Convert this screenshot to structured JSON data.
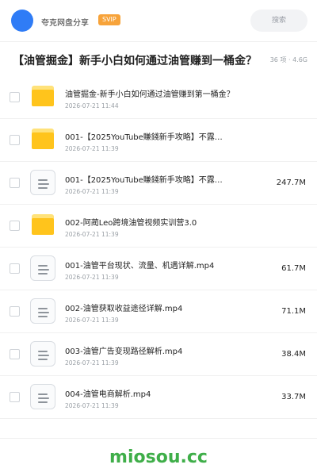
{
  "header": {
    "share_title": "夸克网盘分享",
    "badge": "SVIP",
    "search_placeholder": "搜索",
    "avatar_color": "#2f7cf6"
  },
  "folder": {
    "title": "【油管掘金】新手小白如何通过油管赚到一桶金？",
    "meta": "36 项 · 4.6G"
  },
  "files": [
    {
      "icon": "folder-icon",
      "name": "油管掘金-新手小白如何通过油管赚到第一桶金？",
      "date": "2026-07-21 11:44",
      "size": ""
    },
    {
      "icon": "folder-icon",
      "name": "001-【2025YouTube賺錢新手攻略】不露…",
      "date": "2026-07-21 11:39",
      "size": ""
    },
    {
      "icon": "document-icon",
      "name": "001-【2025YouTube賺錢新手攻略】不露…",
      "date": "2026-07-21 11:39",
      "size": "247.7M"
    },
    {
      "icon": "folder-icon",
      "name": "002-阿蔺Leo跨境油管视频实训营3.0",
      "date": "2026-07-21 11:39",
      "size": ""
    },
    {
      "icon": "document-icon",
      "name": "001-油管平台现状、流量、机遇详解.mp4",
      "date": "2026-07-21 11:39",
      "size": "61.7M"
    },
    {
      "icon": "document-icon",
      "name": "002-油管获取收益途径详解.mp4",
      "date": "2026-07-21 11:39",
      "size": "71.1M"
    },
    {
      "icon": "document-icon",
      "name": "003-油管广告变现路径解析.mp4",
      "date": "2026-07-21 11:39",
      "size": "38.4M"
    },
    {
      "icon": "document-icon",
      "name": "004-油管电商解析.mp4",
      "date": "2026-07-21 11:39",
      "size": "33.7M"
    }
  ],
  "watermark": "miosou.cc",
  "colors": {
    "folder": "#ffc41c",
    "badge": "#f7a33a",
    "watermark": "#3fae49"
  }
}
